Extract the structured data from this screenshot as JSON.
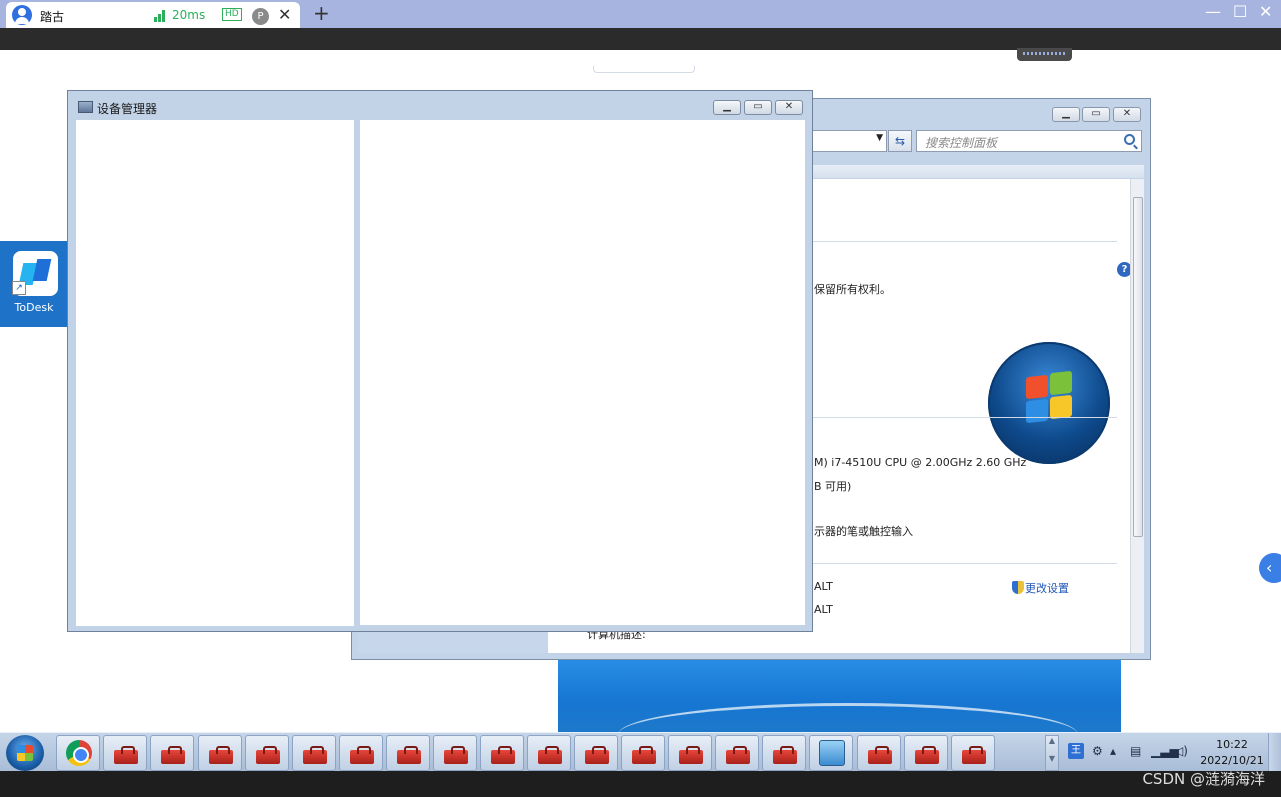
{
  "todesk": {
    "session_name": "踏古",
    "latency": "20ms",
    "hd_badge": "HD",
    "p_badge": "P",
    "close_tab": "✕",
    "new_tab": "+",
    "minimize": "—",
    "maximize": "☐",
    "close": "✕"
  },
  "desktop": {
    "todesk_shortcut_label": "ToDesk"
  },
  "control_panel": {
    "search_placeholder": "搜索控制面板",
    "help": "?",
    "copyright_fragment": "保留所有权利。",
    "cpu_fragment": "M) i7-4510U CPU @ 2.00GHz   2.60 GHz",
    "ram_fragment": "B 可用)",
    "pen_fragment": "示器的笔或触控输入",
    "computer_name_fragment": "ALT",
    "full_name_fragment": "ALT",
    "description_label": "计算机描述:",
    "change_settings": "更改设置"
  },
  "device_manager": {
    "title": "设备管理器"
  },
  "taskbar": {
    "ime": "王",
    "time": "10:22",
    "date": "2022/10/21",
    "toolbox_count": 18
  },
  "watermark": "CSDN @涟漪海洋",
  "side_toggle": "‹"
}
